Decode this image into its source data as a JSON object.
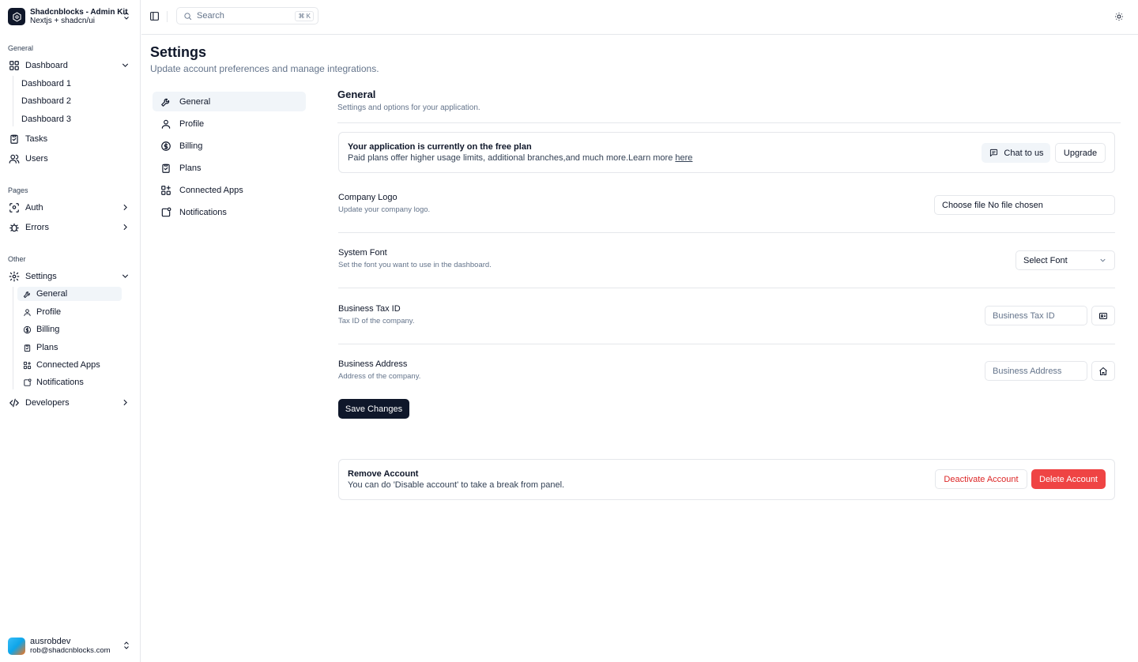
{
  "brand": {
    "title": "Shadcnblocks - Admin Kit",
    "subtitle": "Nextjs + shadcn/ui"
  },
  "sidebar": {
    "groups": [
      {
        "label": "General"
      },
      {
        "label": "Pages"
      },
      {
        "label": "Other"
      }
    ],
    "dashboard": {
      "label": "Dashboard",
      "children": [
        "Dashboard 1",
        "Dashboard 2",
        "Dashboard 3"
      ]
    },
    "tasks": "Tasks",
    "users": "Users",
    "auth": "Auth",
    "errors": "Errors",
    "settings": {
      "label": "Settings",
      "children": [
        "General",
        "Profile",
        "Billing",
        "Plans",
        "Connected Apps",
        "Notifications"
      ]
    },
    "developers": "Developers"
  },
  "user": {
    "name": "ausrobdev",
    "email": "rob@shadcnblocks.com"
  },
  "topbar": {
    "search_placeholder": "Search",
    "shortcut": "⌘ K"
  },
  "page": {
    "title": "Settings",
    "subtitle": "Update account preferences and manage integrations."
  },
  "settings_nav": [
    "General",
    "Profile",
    "Billing",
    "Plans",
    "Connected Apps",
    "Notifications"
  ],
  "section": {
    "title": "General",
    "subtitle": "Settings and options for your application."
  },
  "plan_card": {
    "title": "Your application is currently on the free plan",
    "desc": "Paid plans offer higher usage limits, additional branches,and much more.Learn more ",
    "link": "here",
    "chat_label": "Chat to us",
    "upgrade_label": "Upgrade"
  },
  "fields": {
    "logo": {
      "title": "Company Logo",
      "sub": "Update your company logo.",
      "file_label": "Choose file",
      "file_status": "No file chosen"
    },
    "font": {
      "title": "System Font",
      "sub": "Set the font you want to use in the dashboard.",
      "value": "Select Font"
    },
    "tax": {
      "title": "Business Tax ID",
      "sub": "Tax ID of the company.",
      "placeholder": "Business Tax ID"
    },
    "address": {
      "title": "Business Address",
      "sub": "Address of the company.",
      "placeholder": "Business Address"
    }
  },
  "save_label": "Save Changes",
  "remove_card": {
    "title": "Remove Account",
    "desc": "You can do 'Disable account' to take a break from panel.",
    "deactivate_label": "Deactivate Account",
    "delete_label": "Delete Account"
  },
  "colors": {
    "primary": "#0f172a",
    "danger": "#ef4444",
    "muted": "#64748b",
    "border": "#e5e7eb",
    "accent_bg": "#f1f5f9"
  }
}
